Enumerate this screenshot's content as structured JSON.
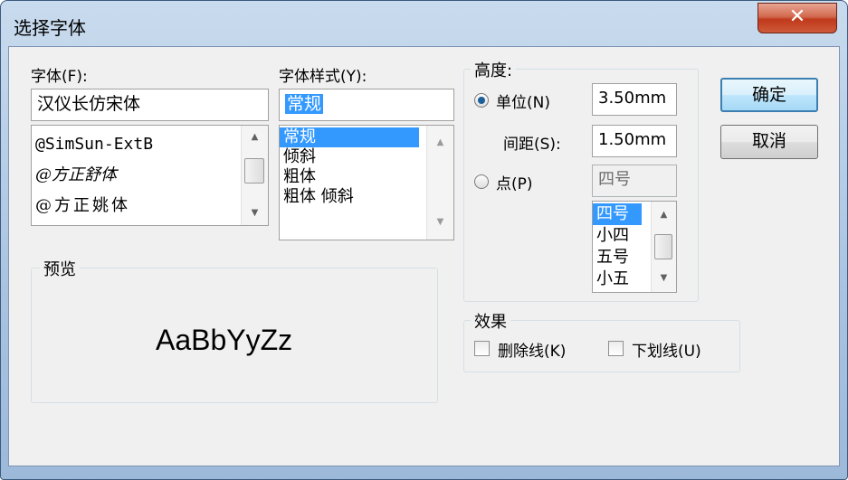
{
  "window": {
    "title": "选择字体",
    "close_glyph": "✕"
  },
  "font": {
    "label": "字体(F):",
    "value": "汉仪长仿宋体",
    "items": [
      "@SimSun-ExtB",
      "@方正舒体",
      "@方正姚体"
    ]
  },
  "style": {
    "label": "字体样式(Y):",
    "value": "常规",
    "items": [
      "常规",
      "倾斜",
      "粗体",
      "粗体 倾斜"
    ],
    "selected_index": 0
  },
  "height": {
    "group_title": "高度:",
    "unit_label": "单位(N)",
    "unit_value": "3.50mm",
    "spacing_label": "间距(S):",
    "spacing_value": "1.50mm",
    "point_label": "点(P)",
    "point_value": "四号",
    "point_items": [
      "四号",
      "小四",
      "五号",
      "小五"
    ],
    "point_selected_index": 0,
    "selected": "unit"
  },
  "preview": {
    "group_title": "预览",
    "sample": "AaBbYyZz"
  },
  "effects": {
    "group_title": "效果",
    "strikethrough_label": "删除线(K)",
    "underline_label": "下划线(U)",
    "strikethrough_checked": false,
    "underline_checked": false
  },
  "buttons": {
    "ok": "确定",
    "cancel": "取消"
  },
  "icons": {
    "close": "close-icon",
    "scroll_up": "scroll-up-arrow-icon",
    "scroll_down": "scroll-down-arrow-icon"
  },
  "colors": {
    "selection": "#3399ff",
    "title_gradient": "#a9c3e1",
    "close_button": "#c0391b"
  }
}
